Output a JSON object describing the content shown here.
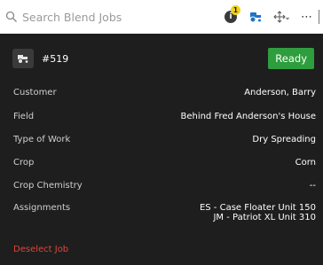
{
  "search": {
    "placeholder": "Search Blend Jobs",
    "value": ""
  },
  "toolbar": {
    "notification_count": "1",
    "info_glyph": "i",
    "icons": [
      "info-icon",
      "tractor-icon",
      "move-icon",
      "more-icon"
    ],
    "more_glyph": "⋯"
  },
  "job": {
    "number": "#519",
    "status": "Ready",
    "status_color": "#2e9d3e"
  },
  "details": {
    "customer_label": "Customer",
    "customer_value": "Anderson, Barry",
    "field_label": "Field",
    "field_value": "Behind Fred Anderson's House",
    "work_label": "Type of Work",
    "work_value": "Dry Spreading",
    "crop_label": "Crop",
    "crop_value": "Corn",
    "chem_label": "Crop Chemistry",
    "chem_value": "--",
    "assign_label": "Assignments",
    "assignments": [
      "ES - Case Floater Unit 150",
      "JM - Patriot XL Unit 310"
    ]
  },
  "actions": {
    "deselect": "Deselect Job",
    "deselect_color": "#e0443a"
  },
  "colors": {
    "background": "#1e1e1e",
    "accent_blue": "#1e73c8",
    "badge_yellow": "#f2d21b"
  }
}
